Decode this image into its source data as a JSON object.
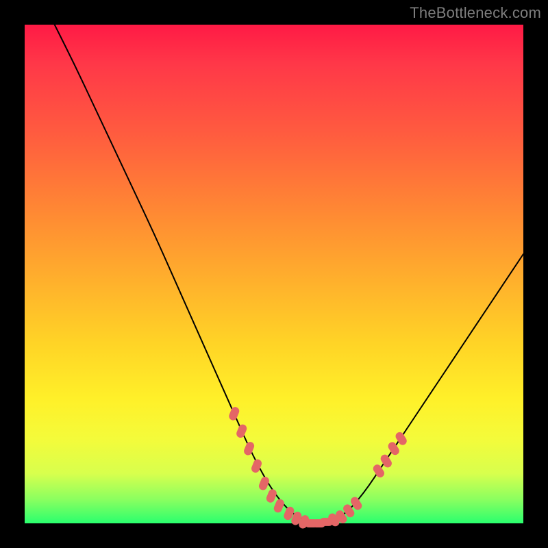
{
  "watermark": "TheBottleneck.com",
  "colors": {
    "background": "#000000",
    "curve": "#000000",
    "marker": "#e46666",
    "gradient_top": "#ff1a45",
    "gradient_bottom": "#2aff6e"
  },
  "chart_data": {
    "type": "line",
    "title": "",
    "xlabel": "",
    "ylabel": "",
    "xlim": [
      0,
      100
    ],
    "ylim": [
      0,
      100
    ],
    "grid": false,
    "legend": false,
    "series": [
      {
        "name": "bottleneck-curve",
        "x": [
          6,
          10,
          14,
          18,
          22,
          26,
          30,
          34,
          38,
          42,
          46,
          50,
          54,
          58,
          60,
          64,
          68,
          72,
          76,
          80,
          84,
          88,
          92,
          96,
          100
        ],
        "y": [
          100,
          92,
          83.5,
          75,
          66.5,
          58,
          49,
          40,
          31,
          22,
          13,
          6,
          1.5,
          0,
          0,
          1.5,
          6,
          12,
          18,
          24,
          30,
          36,
          42,
          48,
          54
        ]
      }
    ],
    "markers": [
      {
        "name": "highlight-markers",
        "color": "#e46666",
        "points": [
          {
            "x": 42,
            "y": 22
          },
          {
            "x": 43.5,
            "y": 18.5
          },
          {
            "x": 45,
            "y": 15
          },
          {
            "x": 46.5,
            "y": 11.5
          },
          {
            "x": 48,
            "y": 8
          },
          {
            "x": 49.5,
            "y": 5.5
          },
          {
            "x": 51,
            "y": 3.5
          },
          {
            "x": 53,
            "y": 2
          },
          {
            "x": 54.5,
            "y": 1
          },
          {
            "x": 56,
            "y": 0.3
          },
          {
            "x": 57.5,
            "y": 0
          },
          {
            "x": 59,
            "y": 0
          },
          {
            "x": 60.5,
            "y": 0.3
          },
          {
            "x": 62,
            "y": 0.7
          },
          {
            "x": 63.5,
            "y": 1.3
          },
          {
            "x": 65,
            "y": 2.5
          },
          {
            "x": 66.5,
            "y": 4
          },
          {
            "x": 71,
            "y": 10.5
          },
          {
            "x": 72.5,
            "y": 12.5
          },
          {
            "x": 74,
            "y": 15
          },
          {
            "x": 75.5,
            "y": 17
          }
        ]
      }
    ]
  }
}
